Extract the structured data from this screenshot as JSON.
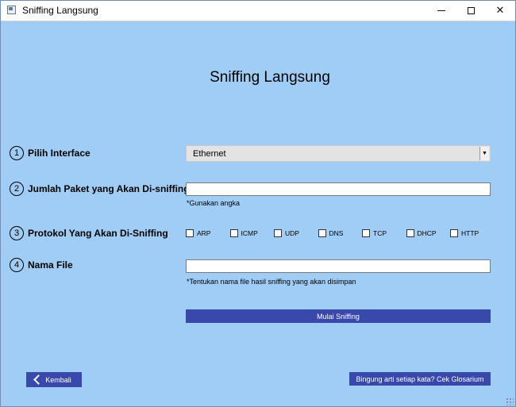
{
  "window": {
    "title": "Sniffing Langsung",
    "icon": "app-window-icon",
    "controls": [
      "minimize-icon",
      "maximize-icon",
      "close-icon"
    ],
    "close_glyph": "✕"
  },
  "page": {
    "heading": "Sniffing Langsung"
  },
  "steps": [
    {
      "number": "1",
      "label": "Pilih Interface"
    },
    {
      "number": "2",
      "label": "Jumlah Paket yang Akan Di-sniffing"
    },
    {
      "number": "3",
      "label": "Protokol Yang Akan Di-Sniffing"
    },
    {
      "number": "4",
      "label": "Nama File"
    }
  ],
  "interface_select": {
    "value": "Ethernet",
    "arrow": "▼"
  },
  "packet_count": {
    "value": "",
    "hint": "*Gunakan angka"
  },
  "protocols": [
    {
      "label": "ARP",
      "checked": false
    },
    {
      "label": "ICMP",
      "checked": false
    },
    {
      "label": "UDP",
      "checked": false
    },
    {
      "label": "DNS",
      "checked": false
    },
    {
      "label": "TCP",
      "checked": false
    },
    {
      "label": "DHCP",
      "checked": false
    },
    {
      "label": "HTTP",
      "checked": false
    }
  ],
  "file_name": {
    "value": "",
    "hint": "*Tentukan nama file hasil sniffing yang akan disimpan"
  },
  "actions": {
    "start_label": "Mulai Sniffing",
    "back_label": "Kembali",
    "glossary_label": "Bingung arti setiap kata? Cek Glosarium"
  },
  "colors": {
    "background": "#a0cdf5",
    "button": "#3949ab",
    "button_text": "#ffffff"
  }
}
